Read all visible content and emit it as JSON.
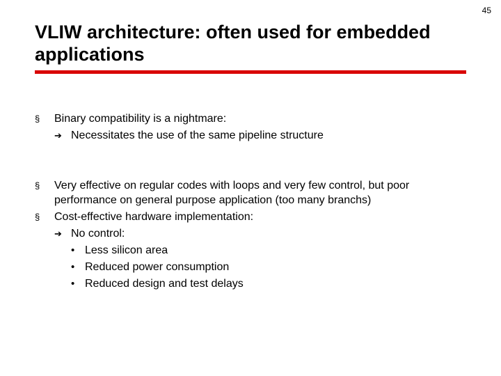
{
  "page_number": "45",
  "title": "VLIW architecture: often used for embedded applications",
  "block1": {
    "item1": "Binary compatibility is a nightmare:",
    "item1_sub1": "Necessitates the use of the same pipeline structure"
  },
  "block2": {
    "item1": "Very effective on regular codes with loops and very few control, but poor performance on general purpose application (too many branchs)",
    "item2": "Cost-effective hardware implementation:",
    "item2_sub1": "No control:",
    "item2_sub1_a": "Less silicon area",
    "item2_sub1_b": "Reduced power consumption",
    "item2_sub1_c": "Reduced design  and test delays"
  }
}
